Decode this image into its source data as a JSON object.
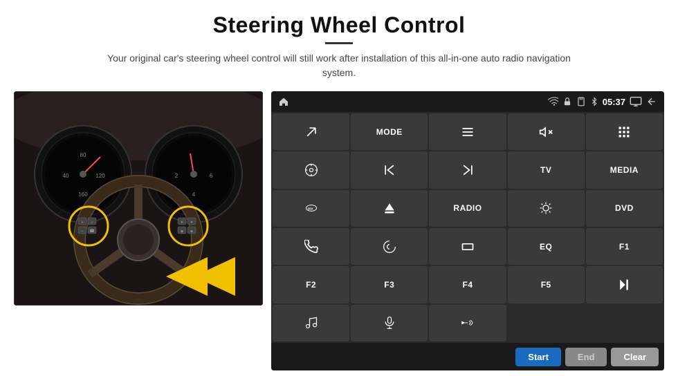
{
  "header": {
    "title": "Steering Wheel Control",
    "subtitle": "Your original car's steering wheel control will still work after installation of this all-in-one auto radio navigation system."
  },
  "statusbar": {
    "time": "05:37"
  },
  "buttons": [
    {
      "id": "nav-home",
      "type": "icon",
      "icon": "home",
      "row": 1,
      "col": 1
    },
    {
      "id": "nav-arrow",
      "type": "icon",
      "icon": "arrow-up-right",
      "row": 1,
      "col": 1
    },
    {
      "id": "mode",
      "label": "MODE",
      "row": 1,
      "col": 2
    },
    {
      "id": "list",
      "type": "icon",
      "icon": "list",
      "row": 1,
      "col": 3
    },
    {
      "id": "mute",
      "type": "icon",
      "icon": "mute",
      "row": 1,
      "col": 4
    },
    {
      "id": "apps",
      "type": "icon",
      "icon": "apps",
      "row": 1,
      "col": 5
    },
    {
      "id": "settings-circle",
      "type": "icon",
      "icon": "settings-circle",
      "row": 2,
      "col": 1
    },
    {
      "id": "prev",
      "type": "icon",
      "icon": "prev",
      "row": 2,
      "col": 2
    },
    {
      "id": "next",
      "type": "icon",
      "icon": "next",
      "row": 2,
      "col": 3
    },
    {
      "id": "tv",
      "label": "TV",
      "row": 2,
      "col": 4
    },
    {
      "id": "media",
      "label": "MEDIA",
      "row": 2,
      "col": 5
    },
    {
      "id": "cam360",
      "type": "icon",
      "icon": "360cam",
      "row": 3,
      "col": 1
    },
    {
      "id": "eject",
      "type": "icon",
      "icon": "eject",
      "row": 3,
      "col": 2
    },
    {
      "id": "radio",
      "label": "RADIO",
      "row": 3,
      "col": 3
    },
    {
      "id": "brightness",
      "type": "icon",
      "icon": "brightness",
      "row": 3,
      "col": 4
    },
    {
      "id": "dvd",
      "label": "DVD",
      "row": 3,
      "col": 5
    },
    {
      "id": "phone",
      "type": "icon",
      "icon": "phone",
      "row": 4,
      "col": 1
    },
    {
      "id": "swirl",
      "type": "icon",
      "icon": "swirl",
      "row": 4,
      "col": 2
    },
    {
      "id": "rectangle",
      "type": "icon",
      "icon": "rect",
      "row": 4,
      "col": 3
    },
    {
      "id": "eq",
      "label": "EQ",
      "row": 4,
      "col": 4
    },
    {
      "id": "f1",
      "label": "F1",
      "row": 4,
      "col": 5
    },
    {
      "id": "f2",
      "label": "F2",
      "row": 5,
      "col": 1
    },
    {
      "id": "f3",
      "label": "F3",
      "row": 5,
      "col": 2
    },
    {
      "id": "f4",
      "label": "F4",
      "row": 5,
      "col": 3
    },
    {
      "id": "f5",
      "label": "F5",
      "row": 5,
      "col": 4
    },
    {
      "id": "play-pause",
      "type": "icon",
      "icon": "playpause",
      "row": 5,
      "col": 5
    },
    {
      "id": "music",
      "type": "icon",
      "icon": "music",
      "row": 6,
      "col": 1
    },
    {
      "id": "mic",
      "type": "icon",
      "icon": "mic",
      "row": 6,
      "col": 2
    },
    {
      "id": "vol-call",
      "type": "icon",
      "icon": "vol-call",
      "row": 6,
      "col": 3
    }
  ],
  "footer": {
    "start_label": "Start",
    "end_label": "End",
    "clear_label": "Clear"
  }
}
